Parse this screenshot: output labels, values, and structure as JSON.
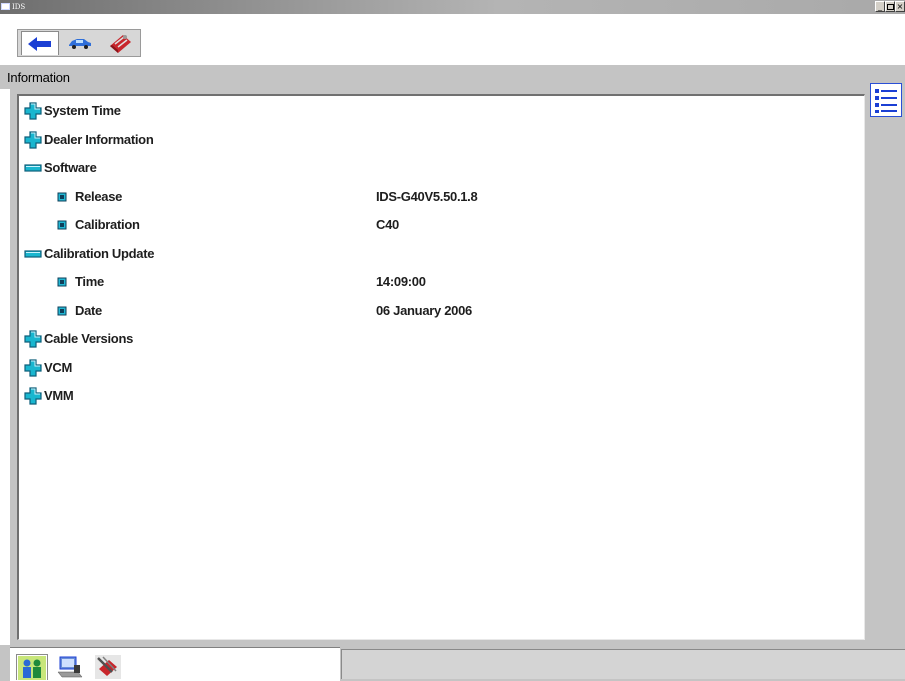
{
  "window": {
    "title": "IDS",
    "controls": [
      "_",
      "8",
      "×"
    ]
  },
  "toolbar": {
    "tabs": [
      {
        "name": "back",
        "icon": "back-arrow-icon",
        "active": true
      },
      {
        "name": "vehicle",
        "icon": "car-icon",
        "active": false
      },
      {
        "name": "toolbox",
        "icon": "toolbox-icon",
        "active": false
      }
    ]
  },
  "panel": {
    "header": "Information"
  },
  "tree": {
    "items": [
      {
        "label": "System Time",
        "state": "collapsed",
        "level": 0,
        "value": ""
      },
      {
        "label": "Dealer Information",
        "state": "collapsed",
        "level": 0,
        "value": ""
      },
      {
        "label": "Software",
        "state": "expanded",
        "level": 0,
        "value": ""
      },
      {
        "label": "Release",
        "state": "leaf",
        "level": 1,
        "value": "IDS-G40V5.50.1.8"
      },
      {
        "label": "Calibration",
        "state": "leaf",
        "level": 1,
        "value": "C40"
      },
      {
        "label": "Calibration Update",
        "state": "expanded",
        "level": 0,
        "value": ""
      },
      {
        "label": "Time",
        "state": "leaf",
        "level": 1,
        "value": "14:09:00"
      },
      {
        "label": "Date",
        "state": "leaf",
        "level": 1,
        "value": "06 January 2006"
      },
      {
        "label": "Cable Versions",
        "state": "collapsed",
        "level": 0,
        "value": ""
      },
      {
        "label": "VCM",
        "state": "collapsed",
        "level": 0,
        "value": ""
      },
      {
        "label": "VMM",
        "state": "collapsed",
        "level": 0,
        "value": ""
      }
    ]
  },
  "statusbar": {
    "tabs": [
      {
        "name": "people",
        "icon": "people-icon",
        "active": true
      },
      {
        "name": "computer",
        "icon": "computer-icon",
        "active": false
      },
      {
        "name": "tools",
        "icon": "tools-icon",
        "active": false
      }
    ],
    "message": ""
  },
  "colors": {
    "expand_icon": "#19b6cf",
    "expand_icon_dark": "#0e5f7a",
    "leaf_icon": "#22b8d4",
    "panel_gray": "#c4c4c4",
    "accent_blue": "#1b3fd4"
  }
}
